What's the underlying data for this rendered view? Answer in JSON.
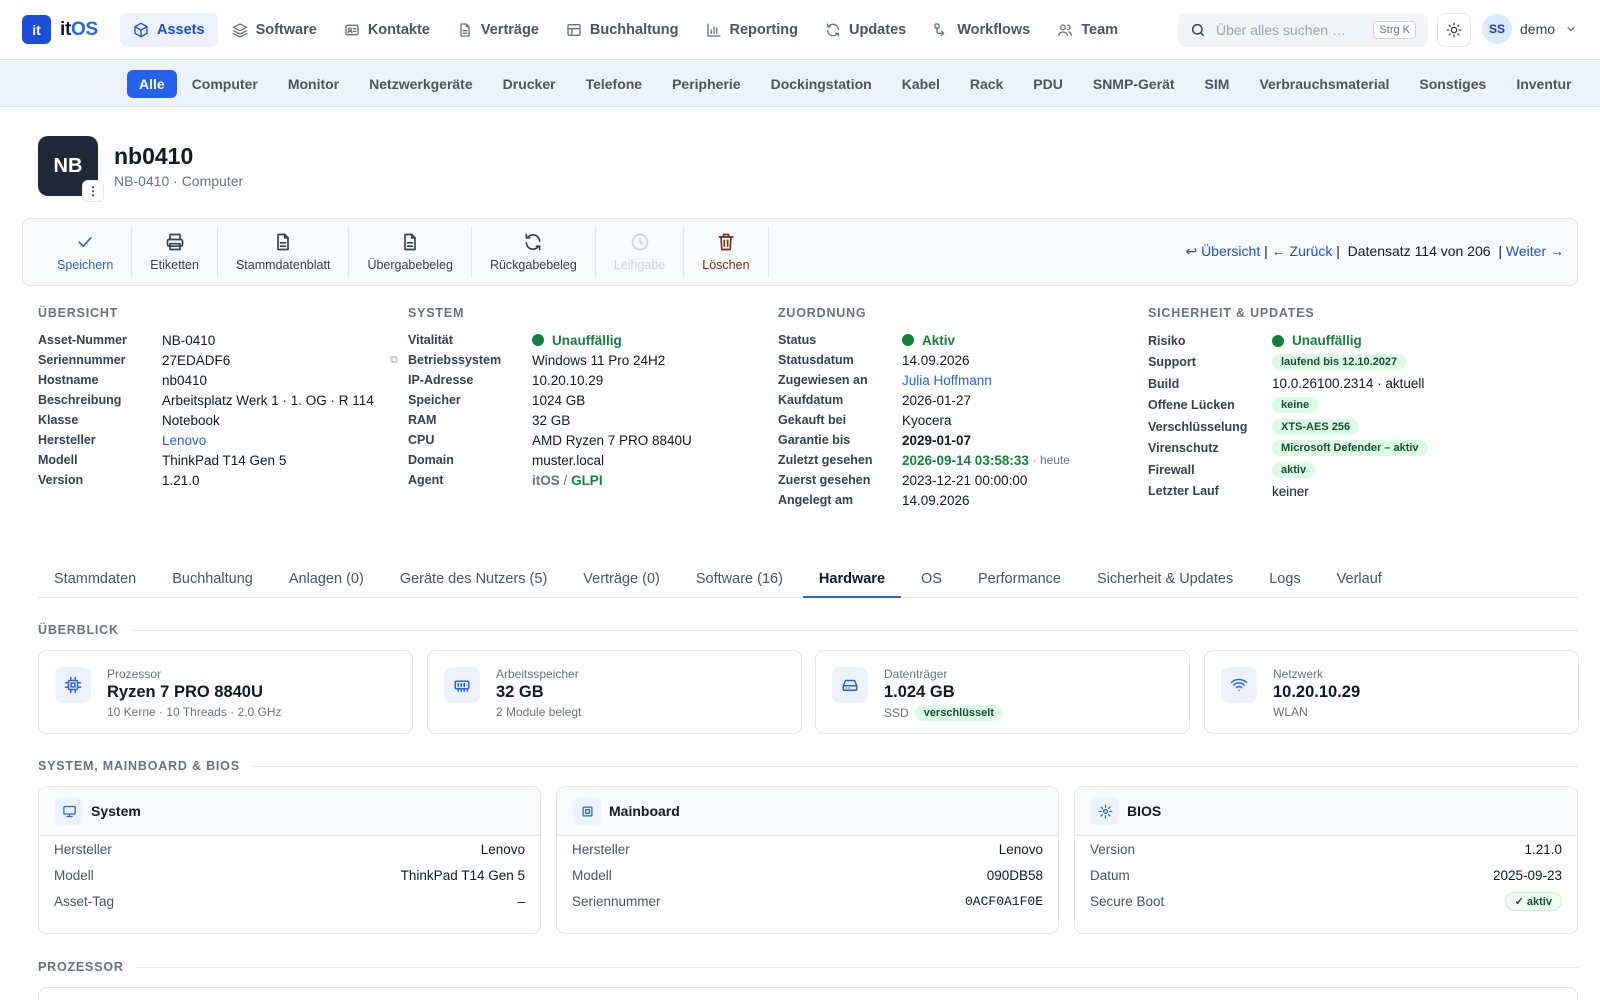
{
  "app": {
    "logo_letters": "it",
    "logo_name_prefix": "it",
    "logo_name_suffix": "OS"
  },
  "topnav": [
    {
      "label": "Assets",
      "icon": "cube-icon"
    },
    {
      "label": "Software",
      "icon": "layers-icon"
    },
    {
      "label": "Kontakte",
      "icon": "contact-card-icon"
    },
    {
      "label": "Verträge",
      "icon": "document-icon"
    },
    {
      "label": "Buchhaltung",
      "icon": "table-icon"
    },
    {
      "label": "Reporting",
      "icon": "bar-chart-icon"
    },
    {
      "label": "Updates",
      "icon": "refresh-icon"
    },
    {
      "label": "Workflows",
      "icon": "workflow-icon"
    },
    {
      "label": "Team",
      "icon": "users-icon"
    }
  ],
  "search": {
    "placeholder": "Über alles suchen …",
    "shortcut": "Strg K"
  },
  "user": {
    "initials": "SS",
    "name": "demo"
  },
  "subnav": [
    "Alle",
    "Computer",
    "Monitor",
    "Netzwerkgeräte",
    "Drucker",
    "Telefone",
    "Peripherie",
    "Dockingstation",
    "Kabel",
    "Rack",
    "PDU",
    "SNMP-Gerät",
    "SIM",
    "Verbrauchsmaterial",
    "Sonstiges",
    "Inventur"
  ],
  "asset": {
    "initials": "NB",
    "more": "⋮",
    "name": "nb0410",
    "subtitle": "NB-0410 · Computer"
  },
  "toolbar": {
    "buttons": [
      "Speichern",
      "Etiketten",
      "Stammdatenblatt",
      "Übergabebeleg",
      "Rückgabebeleg",
      "Leihgabe",
      "Löschen"
    ],
    "nav_overview": "↩ Übersicht",
    "nav_back": "← Zurück",
    "record_text": "Datensatz 114 von 206",
    "nav_next": "Weiter →"
  },
  "overview": {
    "title": "ÜBERSICHT",
    "rows": [
      {
        "k": "Asset-Nummer",
        "v": "NB-0410"
      },
      {
        "k": "Seriennummer",
        "v": "27EDADF6"
      },
      {
        "k": "Hostname",
        "v": "nb0410"
      },
      {
        "k": "Beschreibung",
        "v": "Arbeitsplatz Werk 1 · 1. OG · R 114"
      },
      {
        "k": "Klasse",
        "v": "Notebook"
      },
      {
        "k": "Hersteller",
        "v": "Lenovo"
      },
      {
        "k": "Modell",
        "v": "ThinkPad T14 Gen 5"
      },
      {
        "k": "Version",
        "v": "1.21.0"
      }
    ]
  },
  "system": {
    "title": "SYSTEM",
    "vitality_label": "Vitalität",
    "vitality": "Unauffällig",
    "rows": [
      {
        "k": "Betriebssystem",
        "v": "Windows 11 Pro 24H2"
      },
      {
        "k": "IP-Adresse",
        "v": "10.20.10.29"
      },
      {
        "k": "Speicher",
        "v": "1024 GB"
      },
      {
        "k": "RAM",
        "v": "32 GB"
      },
      {
        "k": "CPU",
        "v": "AMD Ryzen 7 PRO 8840U"
      },
      {
        "k": "Domain",
        "v": "muster.local"
      }
    ],
    "agent_label": "Agent",
    "agent_a": "itOS",
    "agent_sep": "/",
    "agent_b": "GLPI"
  },
  "assignment": {
    "title": "ZUORDNUNG",
    "status_label": "Status",
    "status": "Aktiv",
    "statusdate_label": "Statusdatum",
    "statusdate": "14.09.2026",
    "assigned_label": "Zugewiesen an",
    "assigned": "Julia Hoffmann",
    "purchase_label": "Kaufdatum",
    "purchase": "2026-01-27",
    "vendor_label": "Gekauft bei",
    "vendor": "Kyocera",
    "warranty_label": "Garantie bis",
    "warranty": "2029-01-07",
    "lastseen_label": "Zuletzt gesehen",
    "lastseen": "2026-09-14 03:58:33",
    "lastseen_rel": "· heute",
    "firstseen_label": "Zuerst gesehen",
    "firstseen": "2023-12-21 00:00:00",
    "created_label": "Angelegt am",
    "created": "14.09.2026"
  },
  "security": {
    "title": "SICHERHEIT & UPDATES",
    "risk_label": "Risiko",
    "risk": "Unauffällig",
    "support_label": "Support",
    "support": "laufend bis 12.10.2027",
    "build_label": "Build",
    "build": "10.0.26100.2314 · aktuell",
    "gaps_label": "Offene Lücken",
    "gaps": "keine",
    "encryption_label": "Verschlüsselung",
    "encryption": "XTS-AES 256",
    "av_label": "Virenschutz",
    "av": "Microsoft Defender – aktiv",
    "firewall_label": "Firewall",
    "firewall": "aktiv",
    "lastrun_label": "Letzter Lauf",
    "lastrun": "keiner"
  },
  "tabs": [
    "Stammdaten",
    "Buchhaltung",
    "Anlagen (0)",
    "Geräte des Nutzers (5)",
    "Verträge (0)",
    "Software (16)",
    "Hardware",
    "OS",
    "Performance",
    "Sicherheit & Updates",
    "Logs",
    "Verlauf"
  ],
  "sections": {
    "overview": "ÜBERBLICK",
    "system": "SYSTEM, MAINBOARD & BIOS",
    "cpu": "PROZESSOR"
  },
  "cards": [
    {
      "label": "Prozessor",
      "value": "Ryzen 7 PRO 8840U",
      "detail": "10 Kerne · 10 Threads · 2,0 GHz"
    },
    {
      "label": "Arbeitsspeicher",
      "value": "32 GB",
      "detail": "2 Module belegt"
    },
    {
      "label": "Datenträger",
      "value": "1.024 GB",
      "detail": "SSD",
      "badge": "verschlüsselt"
    },
    {
      "label": "Netzwerk",
      "value": "10.20.10.29",
      "detail": "WLAN"
    }
  ],
  "panels": {
    "system": {
      "title": "System",
      "rows": [
        {
          "k": "Hersteller",
          "v": "Lenovo"
        },
        {
          "k": "Modell",
          "v": "ThinkPad T14 Gen 5"
        },
        {
          "k": "Asset-Tag",
          "v": "–"
        }
      ]
    },
    "mainboard": {
      "title": "Mainboard",
      "rows": [
        {
          "k": "Hersteller",
          "v": "Lenovo"
        },
        {
          "k": "Modell",
          "v": "090DB58"
        },
        {
          "k": "Seriennummer",
          "v": "0ACF0A1F0E"
        }
      ]
    },
    "bios": {
      "title": "BIOS",
      "rows": [
        {
          "k": "Version",
          "v": "1.21.0"
        },
        {
          "k": "Datum",
          "v": "2025-09-23"
        }
      ],
      "secureboot_label": "Secure Boot",
      "secureboot": "✓ aktiv"
    }
  },
  "colors": {
    "accent": "#2563eb",
    "success": "#15803d",
    "dark_tile": "#1f2937"
  }
}
